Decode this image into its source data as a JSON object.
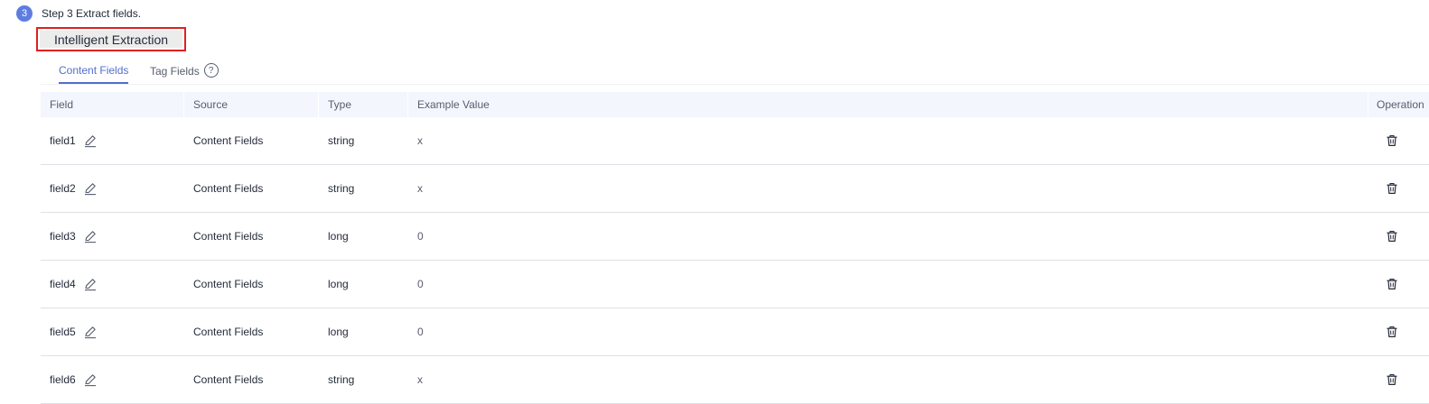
{
  "step": {
    "number": "3",
    "title": "Step 3 Extract fields."
  },
  "extract_button": {
    "label": "Intelligent Extraction"
  },
  "tabs": [
    {
      "label": "Content Fields",
      "active": true
    },
    {
      "label": "Tag Fields",
      "active": false
    }
  ],
  "help_icon": {
    "glyph": "?"
  },
  "table": {
    "columns": [
      "Field",
      "Source",
      "Type",
      "Example Value",
      "Operation"
    ],
    "rows": [
      {
        "field": "field1",
        "source": "Content Fields",
        "type": "string",
        "example": "x"
      },
      {
        "field": "field2",
        "source": "Content Fields",
        "type": "string",
        "example": "x"
      },
      {
        "field": "field3",
        "source": "Content Fields",
        "type": "long",
        "example": "0"
      },
      {
        "field": "field4",
        "source": "Content Fields",
        "type": "long",
        "example": "0"
      },
      {
        "field": "field5",
        "source": "Content Fields",
        "type": "long",
        "example": "0"
      },
      {
        "field": "field6",
        "source": "Content Fields",
        "type": "string",
        "example": "x"
      }
    ]
  },
  "colors": {
    "accent": "#526ecc",
    "step_badge": "#5e7ce0",
    "highlight_border": "#e02020",
    "header_bg": "#f3f6fc"
  },
  "icons": {
    "row_edit": "edit-icon",
    "row_delete": "delete-icon"
  }
}
